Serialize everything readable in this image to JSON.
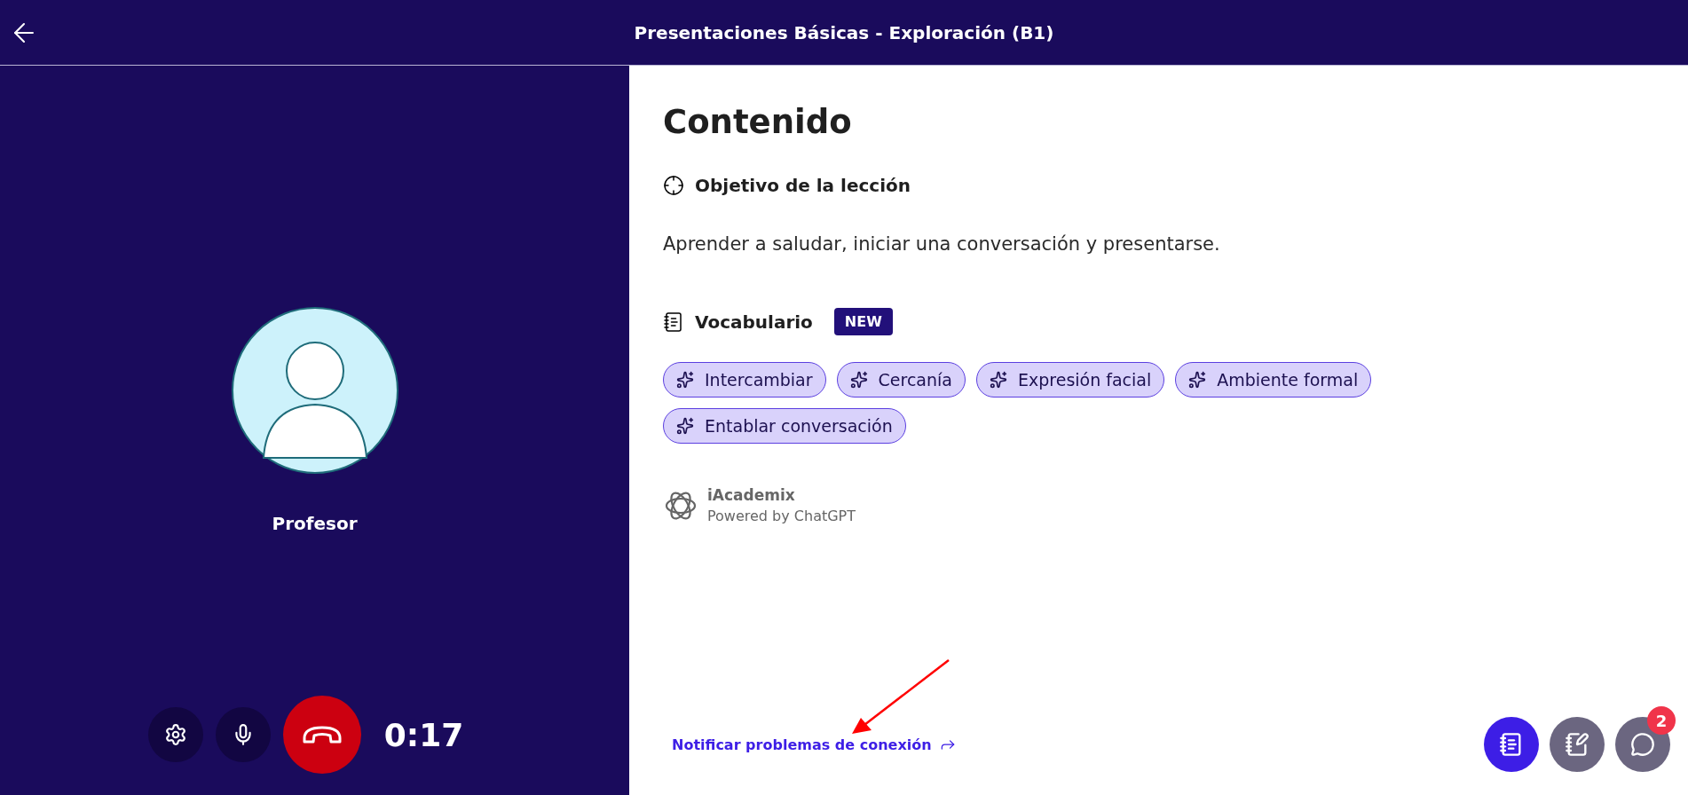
{
  "header": {
    "title": "Presentaciones Básicas - Exploración (B1)"
  },
  "call": {
    "participant": "Profesor",
    "timer": "0:17"
  },
  "content": {
    "title": "Contenido",
    "objective": {
      "heading": "Objetivo de la lección",
      "text": "Aprender a saludar, iniciar una conversación y presentarse."
    },
    "vocabulary": {
      "heading": "Vocabulario",
      "badge": "NEW",
      "words": [
        "Intercambiar",
        "Cercanía",
        "Expresión facial",
        "Ambiente formal",
        "Entablar conversación"
      ]
    },
    "credit": {
      "name": "iAcademix",
      "subtitle": "Powered by ChatGPT"
    },
    "report_link": "Notificar problemas de conexión"
  },
  "side_buttons": [
    {
      "kind": "book",
      "selected": true
    },
    {
      "kind": "notes",
      "selected": false
    },
    {
      "kind": "chat",
      "selected": false,
      "badge": "2"
    }
  ]
}
